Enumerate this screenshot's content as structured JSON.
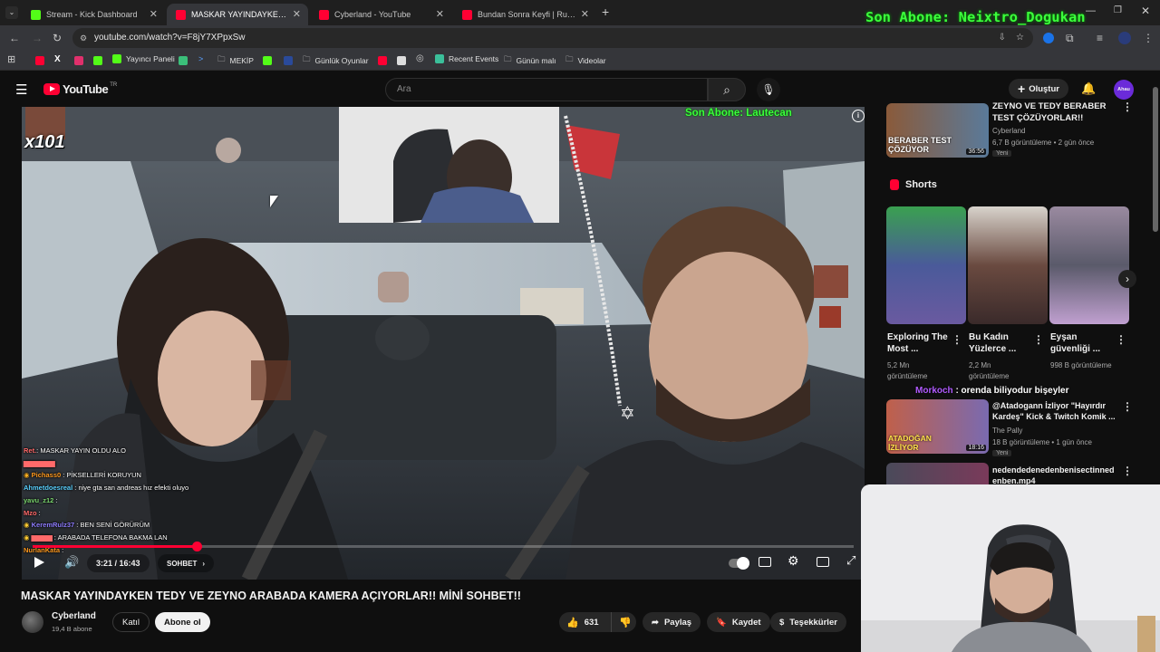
{
  "browser": {
    "tabs": [
      {
        "label": "Stream - Kick Dashboard",
        "favicon_color": "#53fc18"
      },
      {
        "label": "MASKAR YAYINDAYKEN TEDY V",
        "favicon_color": "#ff0033"
      },
      {
        "label": "Cyberland - YouTube",
        "favicon_color": "#ff0033"
      },
      {
        "label": "Bundan Sonra Keyfi | Ruddy - Y",
        "favicon_color": "#ff0033"
      }
    ],
    "url": "youtube.com/watch?v=F8jY7XPpxSw",
    "bookmarks": [
      "Yayıncı Paneli",
      "MEKİP",
      "Günlük Oyunlar",
      "Recent Events",
      "Günün malı",
      "Videolar"
    ]
  },
  "overlay": {
    "top_banner": "Son Abone: Neixtro_Dogukan",
    "video_banner": "Son Abone: Lautecan",
    "combo": "x101"
  },
  "youtube": {
    "logo": "YouTube",
    "logo_suffix": "TR",
    "search_placeholder": "Ara",
    "create_label": "Oluştur",
    "avatar_text": "Ahau"
  },
  "player": {
    "time": "3:21 / 16:43",
    "chapter": "SOHBET",
    "progress": 0.2
  },
  "chat": [
    {
      "user": "Ret.",
      "msg": "MASKAR YAYIN OLDU ALO",
      "color": "#ff6a6a"
    },
    {
      "user": "",
      "msg": "",
      "color": "#ff6a6a"
    },
    {
      "user": "Pichass0",
      "msg": "PİKSELLERİ KORUYUN",
      "color": "#ff9a1f"
    },
    {
      "user": "Ahmetdoesreal",
      "msg": "niye gta san andreas hız efekti oluyo",
      "color": "#5ad1ff"
    },
    {
      "user": "yavu_z12",
      "msg": "",
      "color": "#7bd66f"
    },
    {
      "user": "Mzo",
      "msg": "",
      "color": "#ff6a6a"
    },
    {
      "user": "KeremRulz37",
      "msg": "BEN SENİ GÖRÜRÜM",
      "color": "#8f7dff"
    },
    {
      "user": "",
      "msg": "ARABADA TELEFONA BAKMA LAN",
      "color": "#ff6a6a"
    },
    {
      "user": "NurlanKata",
      "msg": "",
      "color": "#ff9a1f"
    }
  ],
  "video": {
    "title": "MASKAR YAYINDAYKEN TEDY VE ZEYNO ARABADA KAMERA AÇIYORLAR!! MİNİ SOHBET!!",
    "channel": "Cyberland",
    "subscribers": "19,4 B abone",
    "join_label": "Katıl",
    "subscribe_label": "Abone ol",
    "likes": "631",
    "share_label": "Paylaş",
    "save_label": "Kaydet",
    "thanks_label": "Teşekkürler"
  },
  "sidebar": {
    "top_video": {
      "title": "ZEYNO VE TEDY BERABER TEST ÇÖZÜYORLAR!!",
      "channel": "Cyberland",
      "meta": "6,7 B görüntüleme • 2 gün önce",
      "badge": "Yeni",
      "duration": "36:56",
      "thumb_text": "BERABER TEST ÇÖZÜYOR"
    },
    "shorts_label": "Shorts",
    "shorts": [
      {
        "title": "Exploring The Most ...",
        "views": "5,2 Mn görüntüleme"
      },
      {
        "title": "Bu Kadın Yüzlerce ...",
        "views": "2,2 Mn görüntüleme"
      },
      {
        "title": "Eyşan güvenliği ...",
        "views": "998 B görüntüleme"
      }
    ],
    "chat_overlay": {
      "user": "Morkoch",
      "msg": ": orenda biliyodur bişeyler"
    },
    "video2": {
      "title": "@Atadogann İzliyor \"Hayırdır Kardeş\" Kick & Twitch Komik ...",
      "channel": "The Pally",
      "meta": "18 B görüntüleme • 1 gün önce",
      "badge": "Yeni",
      "duration": "18:16",
      "thumb_text": "ATADOĞAN İZLİYOR"
    },
    "video3": {
      "title": "nedendedenedenbenisectinned enben.mp4"
    }
  }
}
